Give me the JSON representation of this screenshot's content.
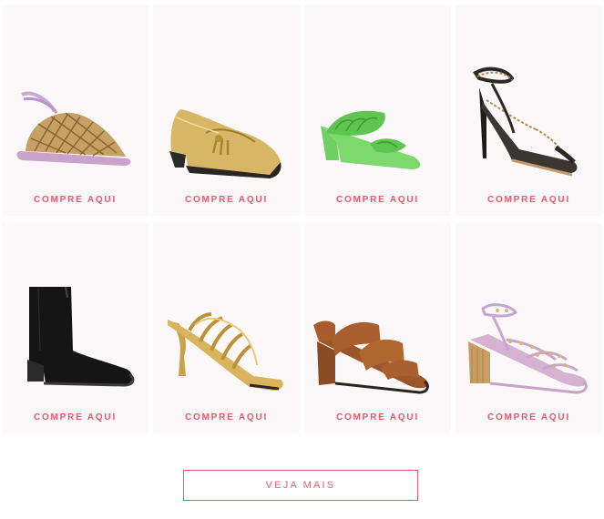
{
  "products": [
    {
      "cta": "COMPRE AQUI",
      "icon": "woven-lace-up-flat-sandal-icon"
    },
    {
      "cta": "COMPRE AQUI",
      "icon": "gold-tassel-loafer-icon"
    },
    {
      "cta": "COMPRE AQUI",
      "icon": "green-braided-mule-icon"
    },
    {
      "cta": "COMPRE AQUI",
      "icon": "chain-strap-stiletto-sandal-icon"
    },
    {
      "cta": "COMPRE AQUI",
      "icon": "black-suede-ankle-boot-icon"
    },
    {
      "cta": "COMPRE AQUI",
      "icon": "gold-caged-heel-mule-icon"
    },
    {
      "cta": "COMPRE AQUI",
      "icon": "brown-suede-block-heel-sandal-icon"
    },
    {
      "cta": "COMPRE AQUI",
      "icon": "studded-block-heel-sandal-icon"
    }
  ],
  "more_button": {
    "label": "VEJA MAIS"
  },
  "colors": {
    "accent": "#e35a6b",
    "card_bg": "#fcf8fa"
  }
}
